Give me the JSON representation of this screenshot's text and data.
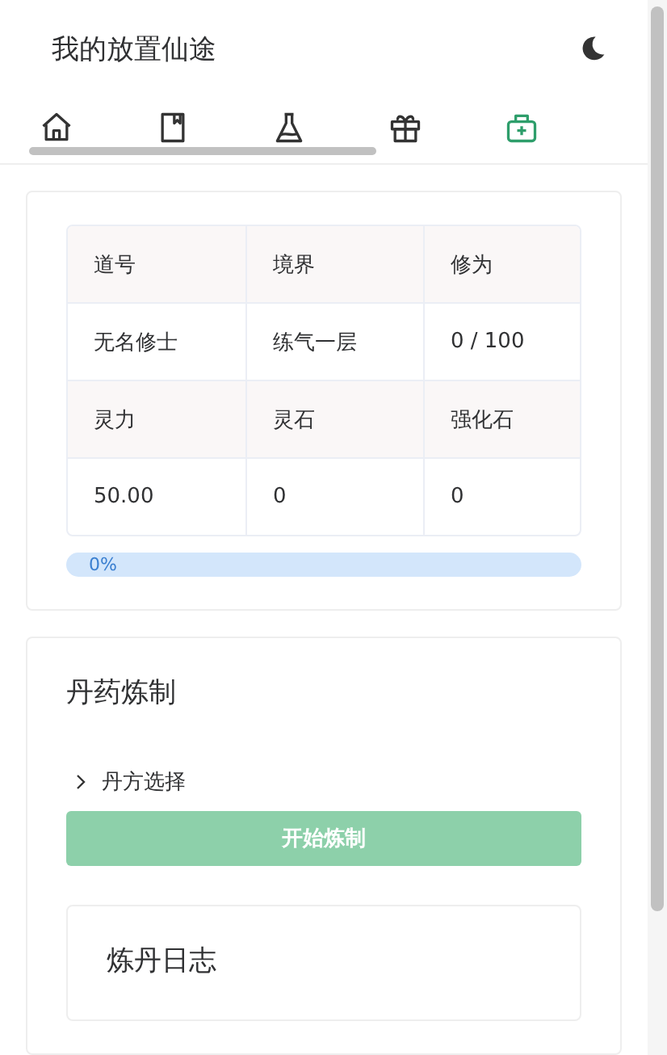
{
  "header": {
    "title": "我的放置仙途"
  },
  "tabs": [
    {
      "kind": "home",
      "selected": false
    },
    {
      "kind": "book",
      "selected": false
    },
    {
      "kind": "flask",
      "selected": false
    },
    {
      "kind": "gift",
      "selected": false
    },
    {
      "kind": "medkit",
      "selected": true
    }
  ],
  "stats": {
    "rows": [
      {
        "cells": [
          "道号",
          "境界",
          "修为"
        ],
        "kind": "head"
      },
      {
        "cells": [
          "无名修士",
          "练气一层",
          "0 / 100"
        ],
        "kind": "body"
      },
      {
        "cells": [
          "灵力",
          "灵石",
          "强化石"
        ],
        "kind": "head"
      },
      {
        "cells": [
          "50.00",
          "0",
          "0"
        ],
        "kind": "body"
      }
    ],
    "progress": {
      "level": 0,
      "reading": "0%"
    }
  },
  "alchemy": {
    "title": "丹药炼制",
    "recipe": {
      "label": "丹方选择",
      "expanded": false
    },
    "button": {
      "label": "开始炼制",
      "disabled": true
    },
    "log": {
      "title": "炼丹日志"
    }
  }
}
